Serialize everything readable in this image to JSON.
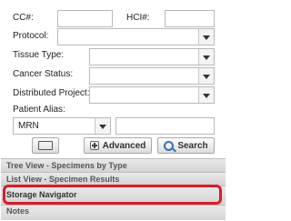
{
  "search_panel": {
    "cc_label": "CC#:",
    "hci_label": "HCI#:",
    "protocol_label": "Protocol:",
    "tissue_type_label": "Tissue Type:",
    "cancer_status_label": "Cancer Status:",
    "distributed_project_label": "Distributed Project:",
    "patient_alias_label": "Patient Alias:",
    "alias_type_value": "MRN",
    "advanced_button": "Advanced",
    "search_button": "Search"
  },
  "nav": {
    "tree_view": "Tree View - Specimens by Type",
    "list_view": "List View - Specimen Results",
    "storage_navigator": "Storage Navigator",
    "notes": "Notes"
  },
  "colors": {
    "highlight": "#d81d27"
  }
}
